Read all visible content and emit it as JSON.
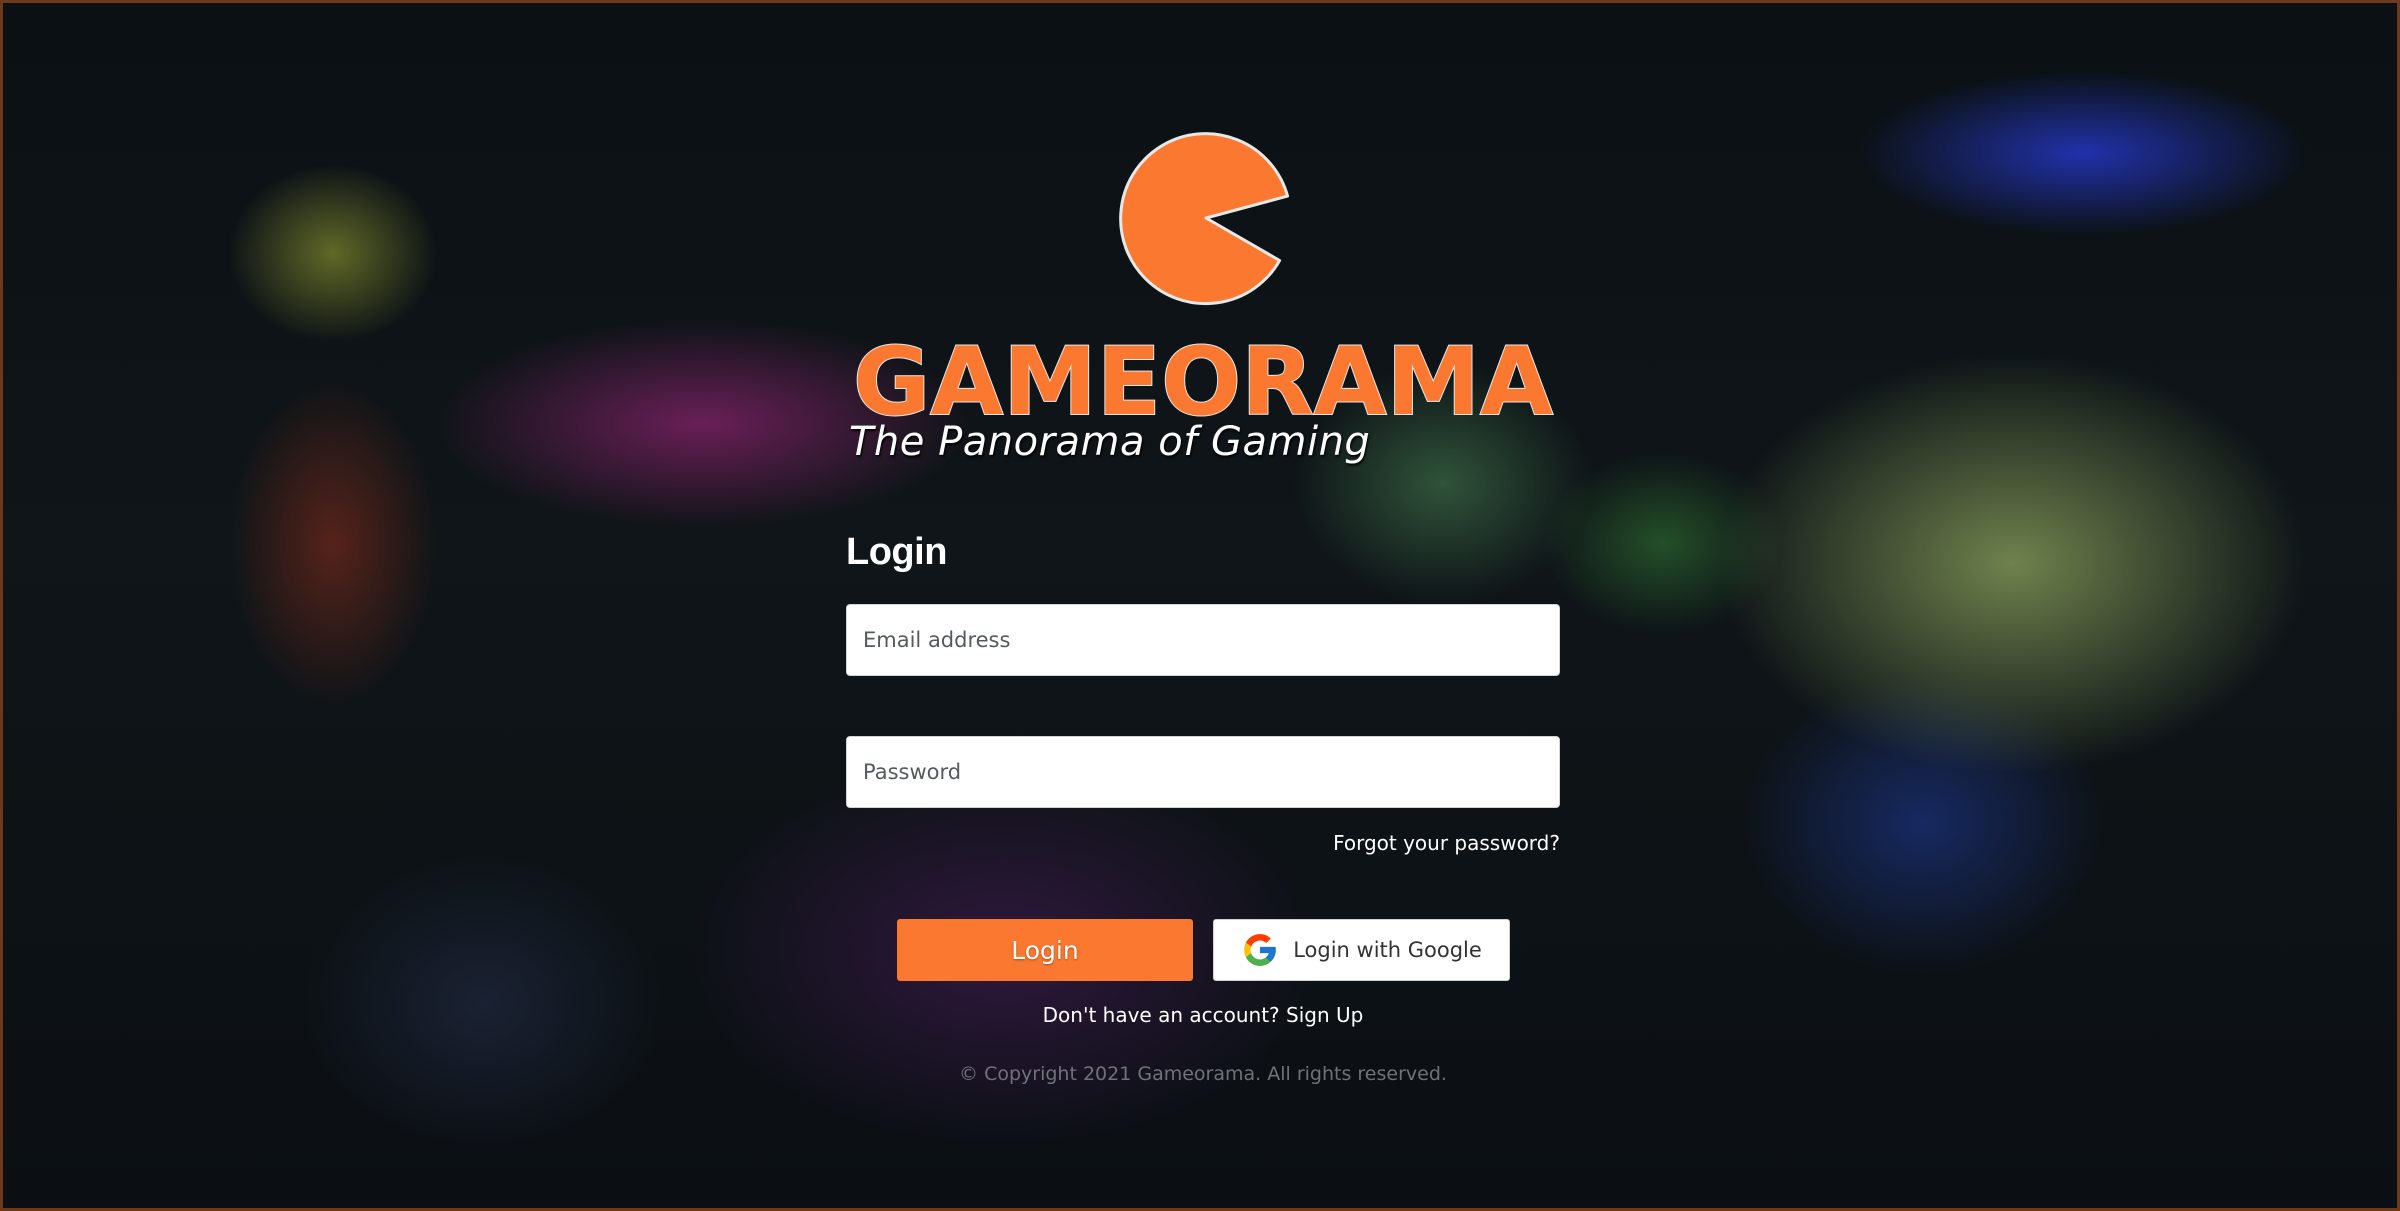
{
  "brand": {
    "name": "GAMEORAMA",
    "tagline": "The Panorama of Gaming",
    "accent_color": "#fb7830"
  },
  "login_form": {
    "heading": "Login",
    "email_placeholder": "Email address",
    "email_value": "",
    "password_placeholder": "Password",
    "password_value": "",
    "forgot_password_label": "Forgot your password?",
    "login_button_label": "Login",
    "google_button_label": "Login with Google",
    "google_icon": "google-g-icon",
    "signup_prompt": "Don't have an account?",
    "signup_link_label": "Sign Up"
  },
  "footer": {
    "copyright": "© Copyright 2021 Gameorama. All rights reserved."
  }
}
